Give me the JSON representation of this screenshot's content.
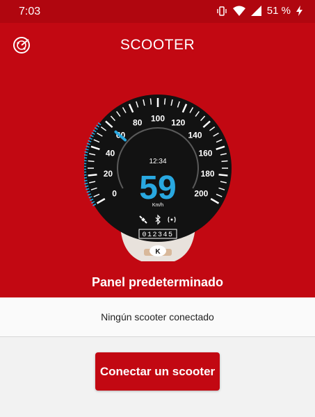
{
  "status_bar": {
    "time": "7:03",
    "battery_percent": "51 %"
  },
  "header": {
    "title": "SCOOTER",
    "radar_icon": "radar-icon"
  },
  "dashboard": {
    "speed": "59",
    "unit": "Km/h",
    "clock": "12:34",
    "odometer": "012345",
    "scale_labels": [
      "0",
      "20",
      "40",
      "60",
      "80",
      "100",
      "120",
      "140",
      "160",
      "180",
      "200"
    ],
    "status_icons": [
      "satellite-icon",
      "bluetooth-icon",
      "signal-icon"
    ],
    "speed_value": 59,
    "speed_max": 200,
    "accent_color": "#29a8e0"
  },
  "panel": {
    "label": "Panel predeterminado"
  },
  "connection": {
    "status_text": "Ningún scooter conectado"
  },
  "actions": {
    "connect_label": "Conectar un scooter"
  },
  "colors": {
    "brand_red": "#c20812",
    "status_red": "#b0060f"
  }
}
